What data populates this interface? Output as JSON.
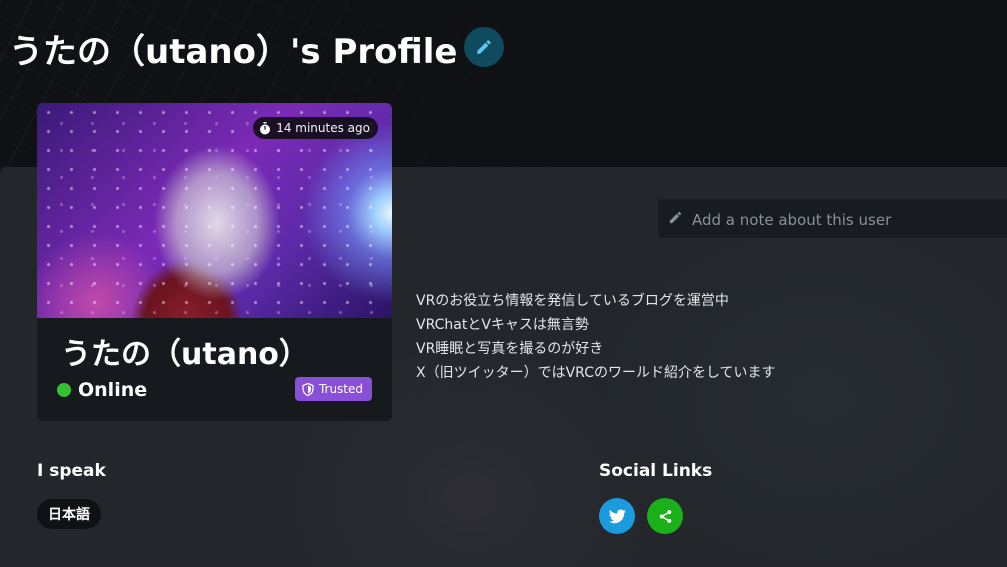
{
  "header": {
    "title": "うたの（utano）'s Profile",
    "edit_icon": "pencil-icon"
  },
  "profile_card": {
    "last_seen": "14 minutes ago",
    "display_name": "うたの（utano）",
    "status": "Online",
    "status_color": "#34c032",
    "trust_rank": "Trusted",
    "trust_color": "#8a4fd8"
  },
  "note": {
    "placeholder": "Add a note about this user",
    "value": ""
  },
  "bio": [
    "VRのお役立ち情報を発信しているブログを運営中",
    "VRChatとVキャスは無言勢",
    "VR睡眠と写真を撮るのが好き",
    "X（旧ツイッター）ではVRCのワールド紹介をしています"
  ],
  "languages": {
    "heading": "I speak",
    "items": [
      "日本語"
    ]
  },
  "social": {
    "heading": "Social Links",
    "links": [
      {
        "icon": "twitter-icon",
        "color": "#1a9bdc"
      },
      {
        "icon": "share-icon",
        "color": "#19b01a"
      }
    ]
  }
}
